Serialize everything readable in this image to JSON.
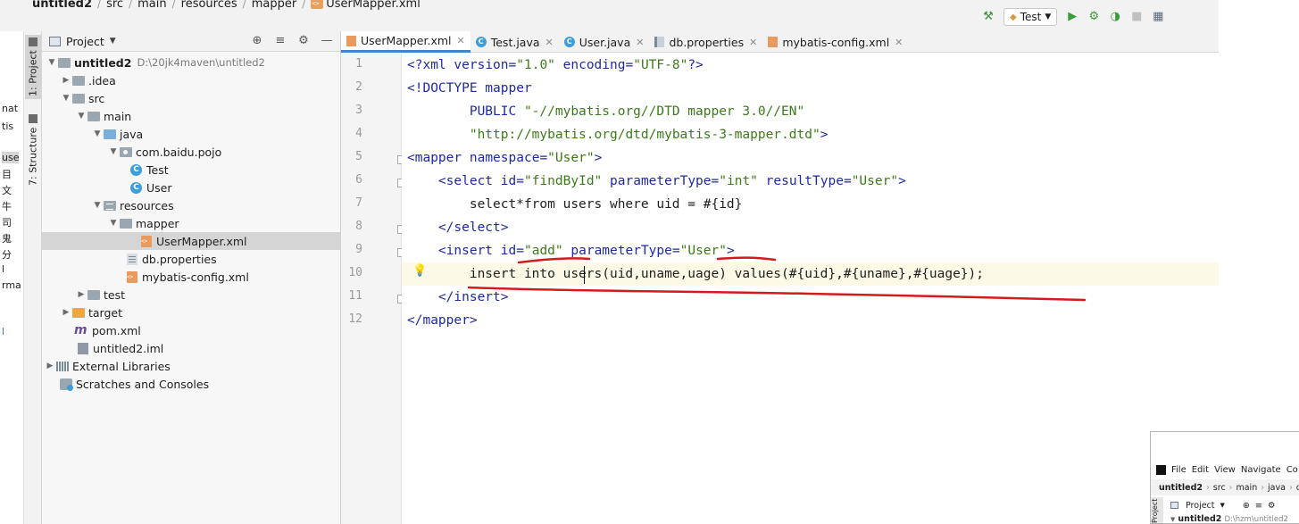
{
  "breadcrumb": [
    "untitled2",
    "src",
    "main",
    "resources",
    "mapper",
    "UserMapper.xml"
  ],
  "toolbar": {
    "run_config": "Test"
  },
  "tool_strip": {
    "project_tab": "1: Project",
    "structure_tab": "7: Structure"
  },
  "left_sliver": [
    "nat",
    "tis",
    "use",
    "目",
    "文",
    "牛",
    "司",
    "鬼",
    "分",
    "l",
    "rma",
    "l"
  ],
  "project_panel": {
    "title": "Project",
    "tree": [
      {
        "label": "untitled2",
        "path": "D:\\20jk4maven\\untitled2"
      },
      {
        "label": ".idea"
      },
      {
        "label": "src"
      },
      {
        "label": "main"
      },
      {
        "label": "java"
      },
      {
        "label": "com.baidu.pojo"
      },
      {
        "label": "Test"
      },
      {
        "label": "User"
      },
      {
        "label": "resources"
      },
      {
        "label": "mapper"
      },
      {
        "label": "UserMapper.xml"
      },
      {
        "label": "db.properties"
      },
      {
        "label": "mybatis-config.xml"
      },
      {
        "label": "test"
      },
      {
        "label": "target"
      },
      {
        "label": "pom.xml"
      },
      {
        "label": "untitled2.iml"
      },
      {
        "label": "External Libraries"
      },
      {
        "label": "Scratches and Consoles"
      }
    ]
  },
  "tabs": [
    "UserMapper.xml",
    "Test.java",
    "User.java",
    "db.properties",
    "mybatis-config.xml"
  ],
  "editor": {
    "line_numbers": [
      "1",
      "2",
      "3",
      "4",
      "5",
      "6",
      "7",
      "8",
      "9",
      "10",
      "11",
      "12"
    ],
    "lines": [
      [
        "<?",
        "xml",
        " ",
        "version",
        "=",
        "\"1.0\"",
        " ",
        "encoding",
        "=",
        "\"UTF-8\"",
        "?>"
      ],
      [
        "<!DOCTYPE mapper"
      ],
      [
        "        PUBLIC ",
        "\"-//mybatis.org//DTD mapper 3.0//EN\""
      ],
      [
        "        ",
        "\"http://mybatis.org/dtd/mybatis-3-mapper.dtd\"",
        ">"
      ],
      [
        "<",
        "mapper",
        " ",
        "namespace",
        "=",
        "\"User\"",
        ">"
      ],
      [
        "    <",
        "select",
        " ",
        "id",
        "=",
        "\"findById\"",
        " ",
        "parameterType",
        "=",
        "\"int\"",
        " ",
        "resultType",
        "=",
        "\"User\"",
        ">"
      ],
      [
        "        select*from users where uid = #{id}"
      ],
      [
        "    </",
        "select",
        ">"
      ],
      [
        "    <",
        "insert",
        " ",
        "id",
        "=",
        "\"add\"",
        " ",
        "parameterType",
        "=",
        "\"User\"",
        ">"
      ],
      [
        "        insert into users(uid,uname,uage) values(#{uid},#{uname},#{uage});"
      ],
      [
        "    </",
        "insert",
        ">"
      ],
      [
        "</",
        "mapper",
        ">"
      ]
    ]
  },
  "mini_window": {
    "menu": [
      "File",
      "Edit",
      "View",
      "Navigate",
      "Co"
    ],
    "crumbs": [
      "untitled2",
      "src",
      "main",
      "java",
      "com"
    ],
    "header": "Project",
    "tree_label": "untitled2",
    "tree_path": "D:\\hzm\\untitled2",
    "vstrip": "Project"
  },
  "colors": {
    "tag": "#1f2aa0",
    "string": "#3d7a1a",
    "selection": "#d5d5d5",
    "annotation": "#d41b1b"
  }
}
